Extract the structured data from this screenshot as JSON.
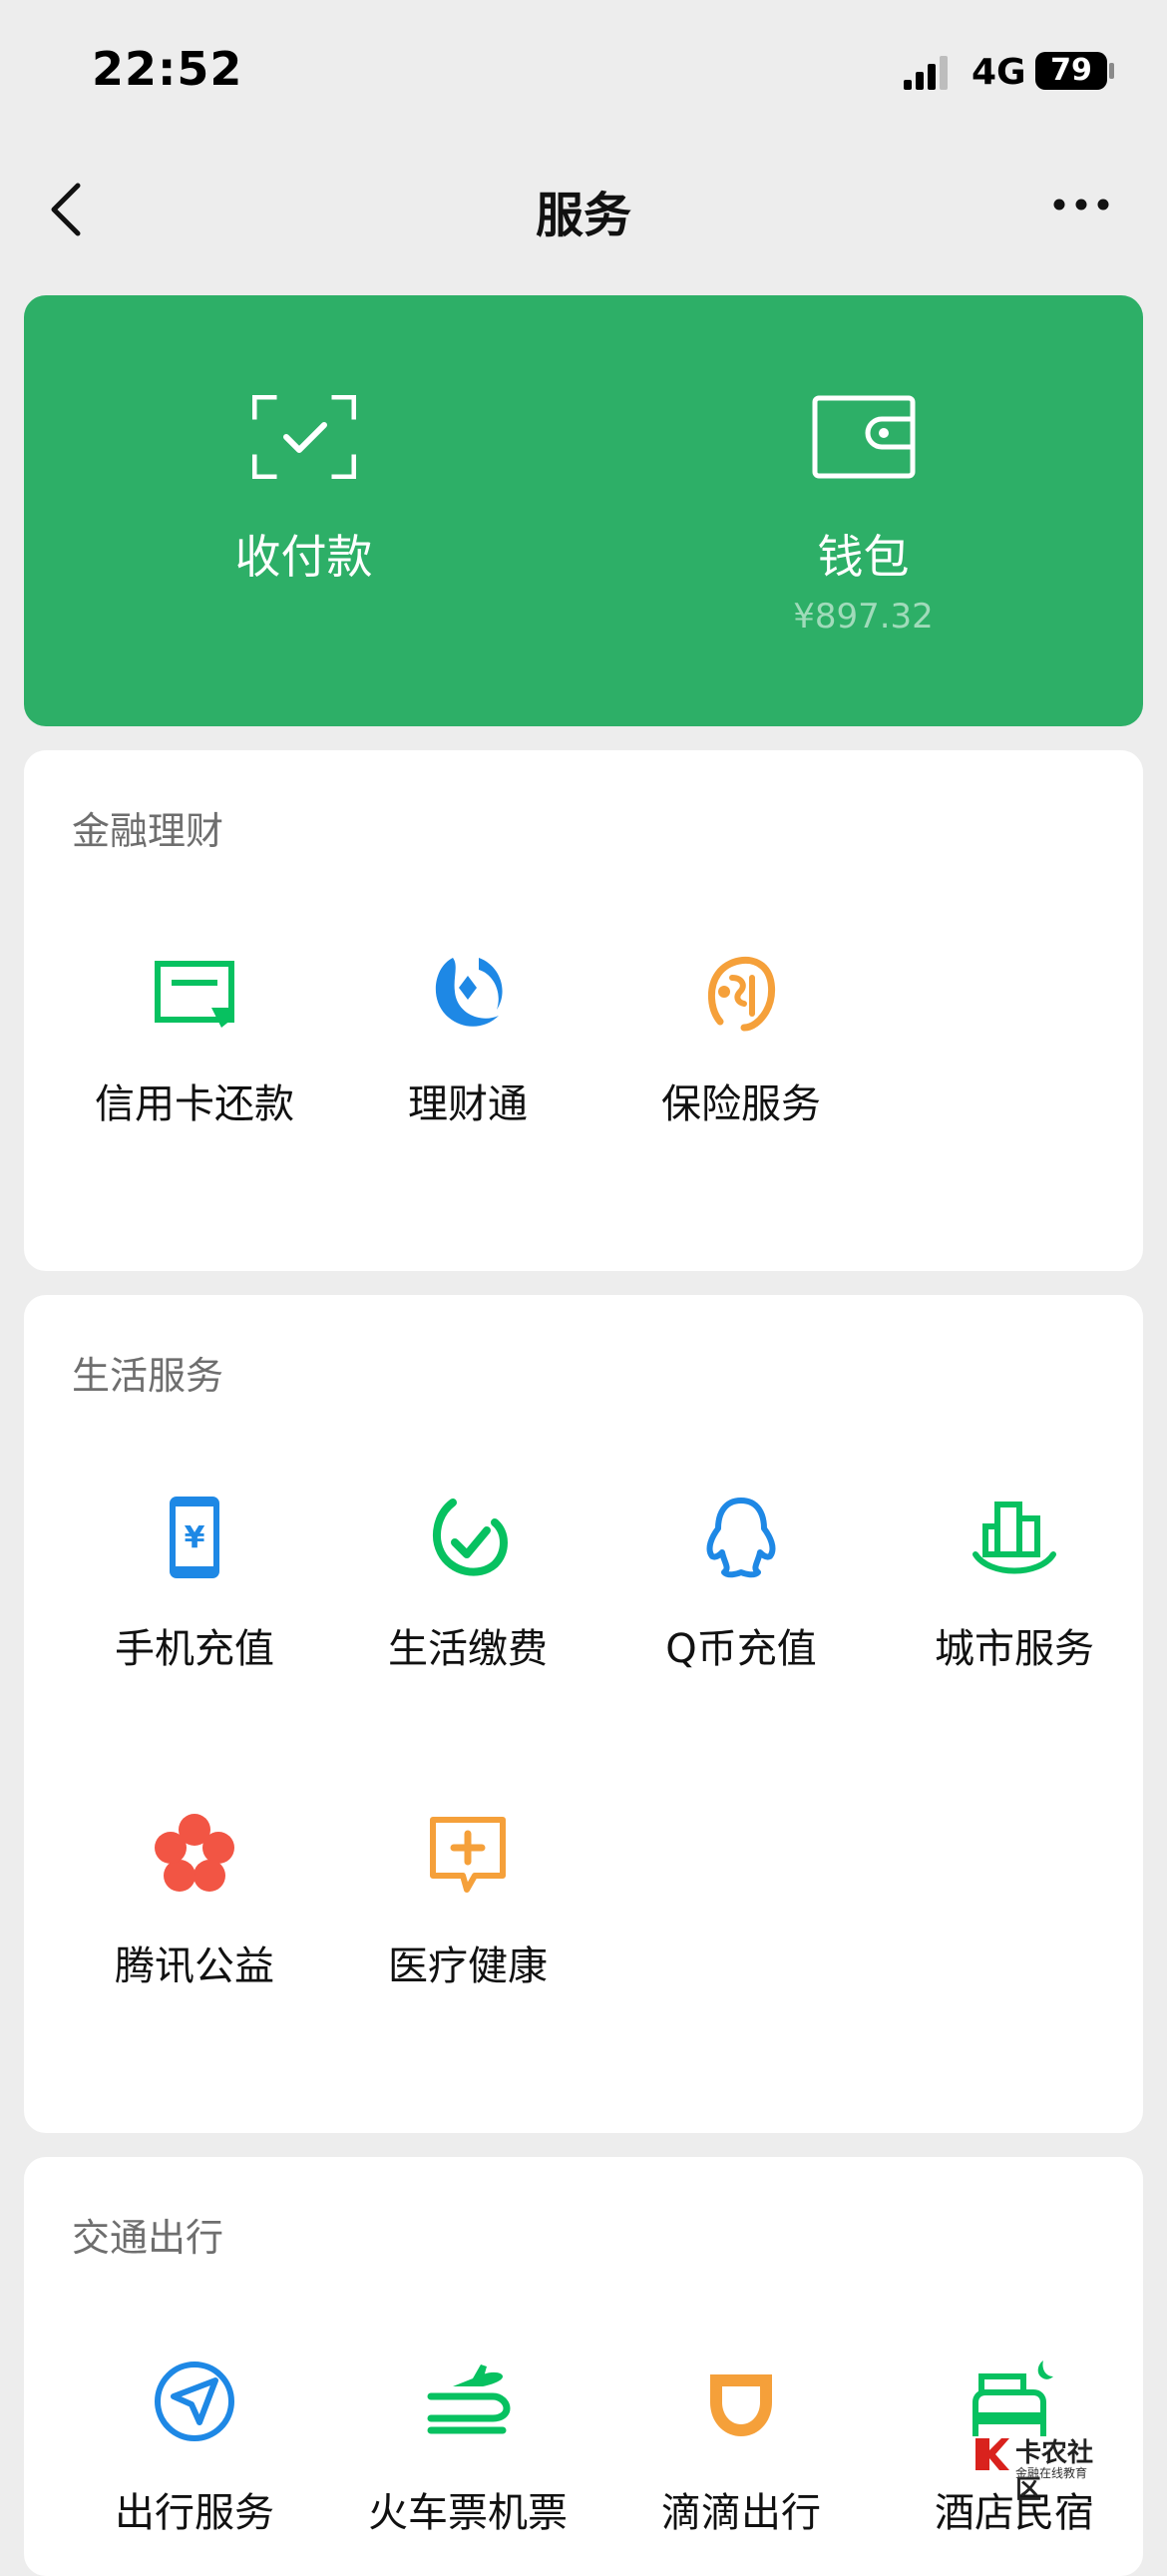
{
  "status_bar": {
    "time": "22:52",
    "network": "4G",
    "battery": "79"
  },
  "navbar": {
    "title": "服务",
    "back_icon": "chevron-left-icon",
    "more_icon": "more-horizontal-icon"
  },
  "wallet_card": {
    "pay": {
      "label": "收付款",
      "icon": "scan-check-icon"
    },
    "wallet": {
      "label": "钱包",
      "balance": "¥897.32",
      "icon": "wallet-icon"
    },
    "color": "#2daf67"
  },
  "sections": {
    "finance": {
      "title": "金融理财",
      "items": [
        {
          "label": "信用卡还款",
          "icon": "credit-card-icon"
        },
        {
          "label": "理财通",
          "icon": "licaitong-icon"
        },
        {
          "label": "保险服务",
          "icon": "insurance-icon"
        }
      ]
    },
    "life": {
      "title": "生活服务",
      "items": [
        {
          "label": "手机充值",
          "icon": "phone-recharge-icon"
        },
        {
          "label": "生活缴费",
          "icon": "bill-payment-icon"
        },
        {
          "label": "Q币充值",
          "icon": "qq-penguin-icon"
        },
        {
          "label": "城市服务",
          "icon": "city-icon"
        },
        {
          "label": "腾讯公益",
          "icon": "charity-flower-icon"
        },
        {
          "label": "医疗健康",
          "icon": "medical-icon"
        }
      ]
    },
    "transport": {
      "title": "交通出行",
      "items": [
        {
          "label": "出行服务",
          "icon": "navigation-icon"
        },
        {
          "label": "火车票机票",
          "icon": "train-plane-icon"
        },
        {
          "label": "滴滴出行",
          "icon": "didi-icon"
        },
        {
          "label": "酒店民宿",
          "icon": "hotel-bed-icon"
        }
      ]
    }
  },
  "watermark": {
    "title": "卡农社区",
    "subtitle": "金融在线教育"
  },
  "colors": {
    "green": "#07c160",
    "blue": "#1e88e5",
    "orange": "#f5a03a",
    "red": "#f25544"
  }
}
